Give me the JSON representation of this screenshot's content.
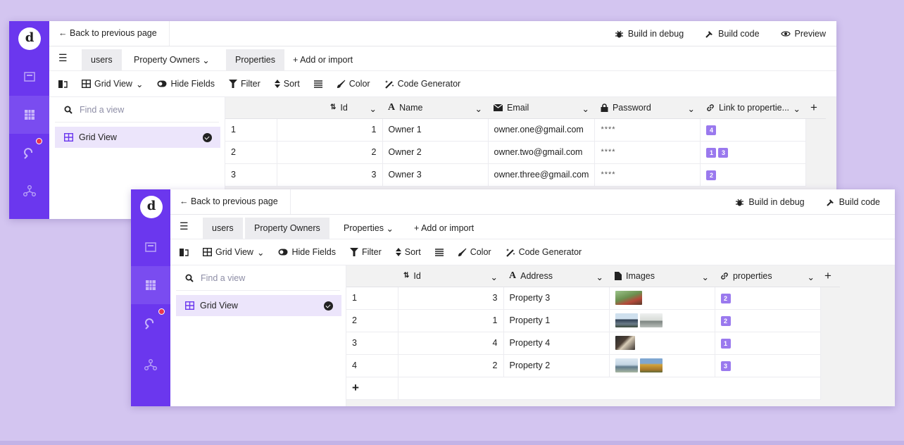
{
  "win1": {
    "back_label": "Back to previous page",
    "actions": [
      "Build in debug",
      "Build code",
      "Preview"
    ],
    "tabs": [
      "users",
      "Property Owners",
      "Properties",
      "+ Add or import"
    ],
    "toolbar": [
      "Grid View",
      "Hide Fields",
      "Filter",
      "Sort",
      "Color",
      "Code Generator"
    ],
    "search_placeholder": "Find a view",
    "view_label": "Grid View",
    "columns": [
      "Id",
      "Name",
      "Email",
      "Password",
      "Link to propertie..."
    ],
    "rows": [
      {
        "n": "1",
        "id": "1",
        "name": "Owner 1",
        "email": "owner.one@gmail.com",
        "password": "****",
        "links": [
          "4"
        ]
      },
      {
        "n": "2",
        "id": "2",
        "name": "Owner 2",
        "email": "owner.two@gmail.com",
        "password": "****",
        "links": [
          "1",
          "3"
        ]
      },
      {
        "n": "3",
        "id": "3",
        "name": "Owner 3",
        "email": "owner.three@gmail.com",
        "password": "****",
        "links": [
          "2"
        ]
      }
    ]
  },
  "win2": {
    "back_label": "Back to previous page",
    "actions": [
      "Build in debug",
      "Build code"
    ],
    "tabs": [
      "users",
      "Property Owners",
      "Properties",
      "+ Add or import"
    ],
    "toolbar": [
      "Grid View",
      "Hide Fields",
      "Filter",
      "Sort",
      "Color",
      "Code Generator"
    ],
    "search_placeholder": "Find a view",
    "view_label": "Grid View",
    "columns": [
      "Id",
      "Address",
      "Images",
      "properties"
    ],
    "rows": [
      {
        "n": "1",
        "id": "3",
        "address": "Property 3",
        "links": [
          "2"
        ]
      },
      {
        "n": "2",
        "id": "1",
        "address": "Property 1",
        "links": [
          "2"
        ]
      },
      {
        "n": "3",
        "id": "4",
        "address": "Property 4",
        "links": [
          "1"
        ]
      },
      {
        "n": "4",
        "id": "2",
        "address": "Property 2",
        "links": [
          "3"
        ]
      }
    ],
    "add_row_label": "+"
  },
  "colors": {
    "accent": "#6b37ee",
    "badge": "#9a79ee",
    "page_bg": "#d3c5f0",
    "notify": "#e8354d"
  }
}
